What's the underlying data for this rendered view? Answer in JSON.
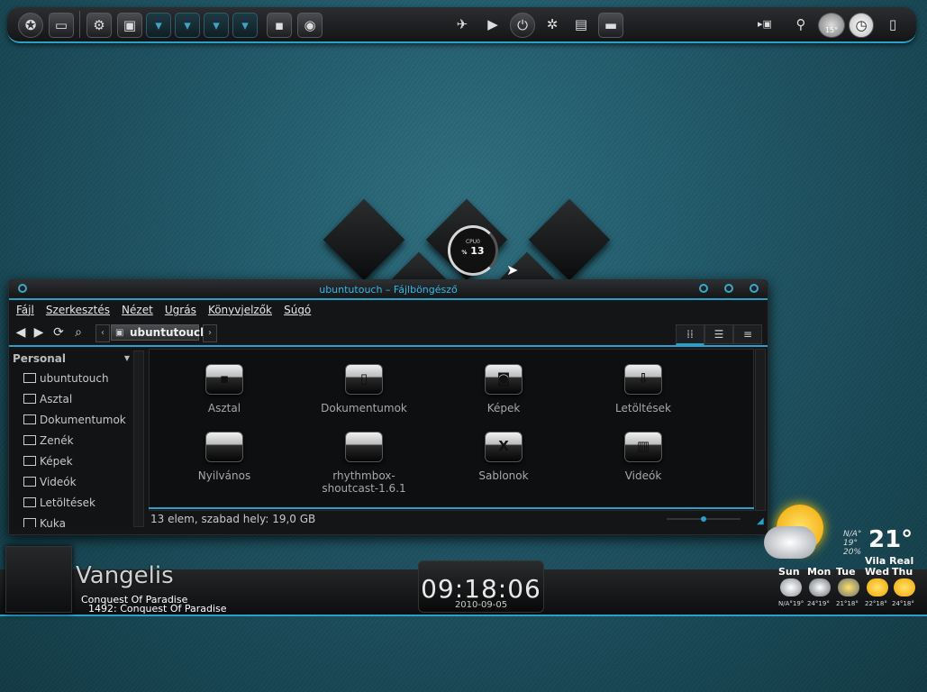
{
  "top_panel": {
    "weather_temp": "15°"
  },
  "gauge": {
    "label": "CPU0",
    "percent": "%",
    "value": "13"
  },
  "window": {
    "title": "ubuntutouch – Fájlböngésző",
    "menu": [
      "Fájl",
      "Szerkesztés",
      "Nézet",
      "Ugrás",
      "Könyvjelzők",
      "Súgó"
    ],
    "location": "ubuntutouch",
    "sidebar": {
      "heading": "Personal",
      "items": [
        "ubuntutouch",
        "Asztal",
        "Dokumentumok",
        "Zenék",
        "Képek",
        "Videók",
        "Letöltések",
        "Kuka"
      ]
    },
    "files": [
      {
        "name": "Asztal",
        "icon": "desktop-icon"
      },
      {
        "name": "Dokumentumok",
        "icon": "document-icon"
      },
      {
        "name": "Képek",
        "icon": "camera-icon"
      },
      {
        "name": "Letöltések",
        "icon": "download-icon"
      },
      {
        "name": "Nyilvános",
        "icon": "folder-icon"
      },
      {
        "name": "rhythmbox-shoutcast-1.6.1",
        "icon": "folder-icon"
      },
      {
        "name": "Sablonok",
        "icon": "template-icon"
      },
      {
        "name": "Videók",
        "icon": "film-icon"
      }
    ],
    "status": "13 elem, szabad hely: 19,0 GB"
  },
  "music": {
    "artist": "Vangelis",
    "album": "Conquest Of Paradise",
    "track": "1492: Conquest Of Paradise"
  },
  "clock": {
    "time": "09:18:06",
    "date": "2010-09-05"
  },
  "weather": {
    "temp": "21°",
    "na": "N/A°",
    "feels": "19°",
    "humidity": "20%",
    "city": "Vila Real",
    "days": [
      {
        "day": "Sun",
        "temps": "N/A°19°"
      },
      {
        "day": "Mon",
        "temps": "24°19°"
      },
      {
        "day": "Tue",
        "temps": "21°18°"
      },
      {
        "day": "Wed",
        "temps": "22°18°"
      },
      {
        "day": "Thu",
        "temps": "24°18°"
      }
    ]
  },
  "colors": {
    "accent": "#2aa0c8",
    "title": "#33b9e8"
  }
}
